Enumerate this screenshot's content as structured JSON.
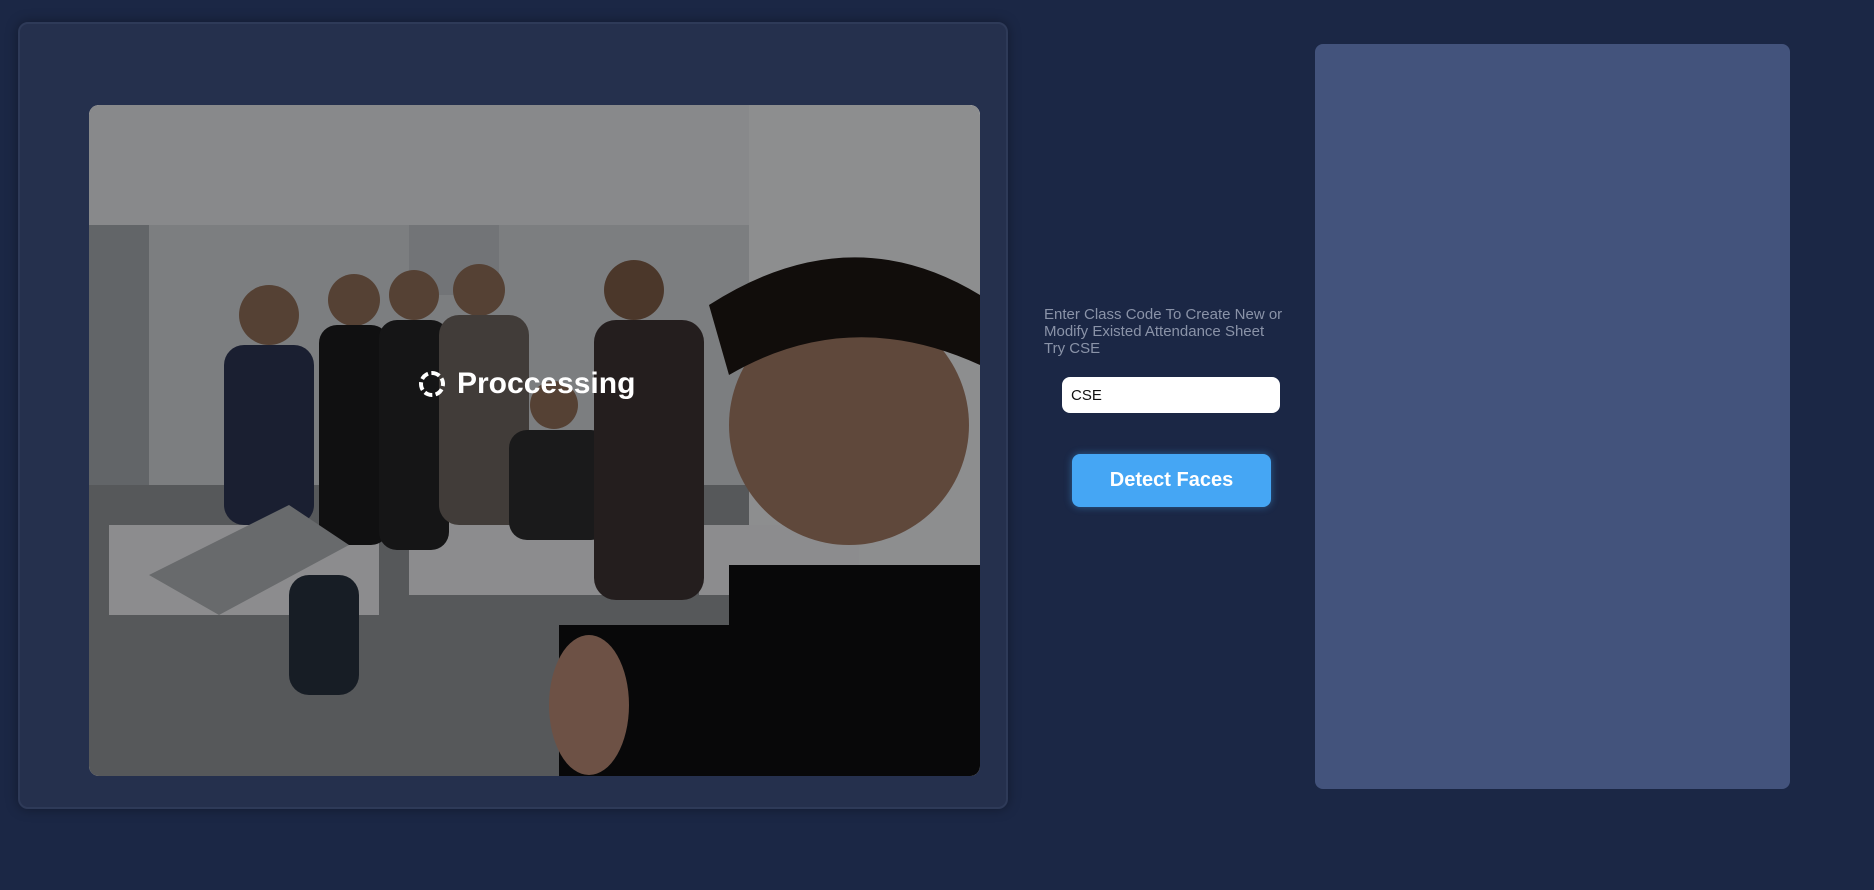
{
  "image_panel": {
    "processing_label": "Proccessing"
  },
  "controls": {
    "prompt_line1": "Enter Class Code To Create New or",
    "prompt_line2": "Modify Existed Attendance Sheet",
    "prompt_line3": "Try CSE",
    "class_code_value": "CSE",
    "detect_button_label": "Detect Faces"
  },
  "colors": {
    "background": "#1b2745",
    "panel": "#25304d",
    "results_panel": "#43537c",
    "accent": "#45a6f4"
  },
  "icons": {
    "loading": "spinner-icon"
  }
}
